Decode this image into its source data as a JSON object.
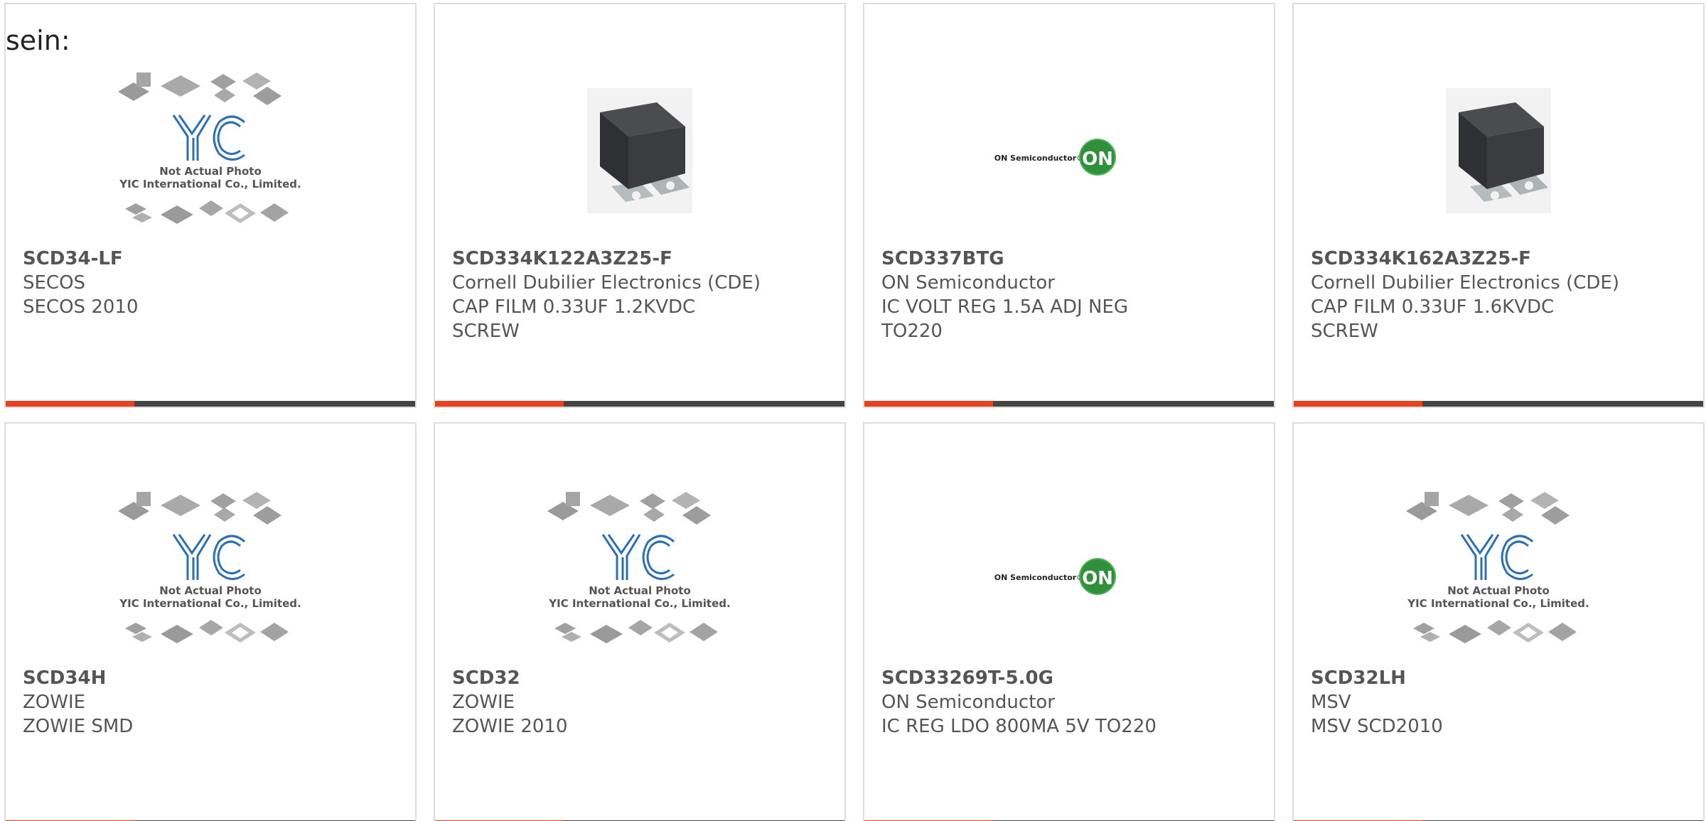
{
  "intro_text": "sein:",
  "colors": {
    "accent": "#e8401c",
    "bar": "#444444",
    "border": "#dddddd"
  },
  "placeholder": {
    "line1": "Not Actual Photo",
    "line2": "YIC International Co., Limited.",
    "logo": "YIC"
  },
  "onsemi_logo_text": "ON Semiconductor",
  "onsemi_badge": "ON",
  "products": [
    {
      "part": "SCD34-LF",
      "manufacturer": "SECOS",
      "description": "SECOS 2010",
      "description2": "",
      "image": "yic-placeholder"
    },
    {
      "part": "SCD334K122A3Z25-F",
      "manufacturer": "Cornell Dubilier Electronics (CDE)",
      "description": "CAP FILM 0.33UF 1.2KVDC",
      "description2": "SCREW",
      "image": "film-capacitor"
    },
    {
      "part": "SCD337BTG",
      "manufacturer": "ON Semiconductor",
      "description": "IC VOLT REG 1.5A ADJ NEG",
      "description2": "TO220",
      "image": "onsemi-logo"
    },
    {
      "part": "SCD334K162A3Z25-F",
      "manufacturer": "Cornell Dubilier Electronics (CDE)",
      "description": "CAP FILM 0.33UF 1.6KVDC",
      "description2": "SCREW",
      "image": "film-capacitor"
    },
    {
      "part": "SCD34H",
      "manufacturer": "ZOWIE",
      "description": "ZOWIE SMD",
      "description2": "",
      "image": "yic-placeholder"
    },
    {
      "part": "SCD32",
      "manufacturer": "ZOWIE",
      "description": "ZOWIE 2010",
      "description2": "",
      "image": "yic-placeholder"
    },
    {
      "part": "SCD33269T-5.0G",
      "manufacturer": "ON Semiconductor",
      "description": "IC REG LDO 800MA 5V TO220",
      "description2": "",
      "image": "onsemi-logo"
    },
    {
      "part": "SCD32LH",
      "manufacturer": "MSV",
      "description": "MSV SCD2010",
      "description2": "",
      "image": "yic-placeholder"
    }
  ]
}
